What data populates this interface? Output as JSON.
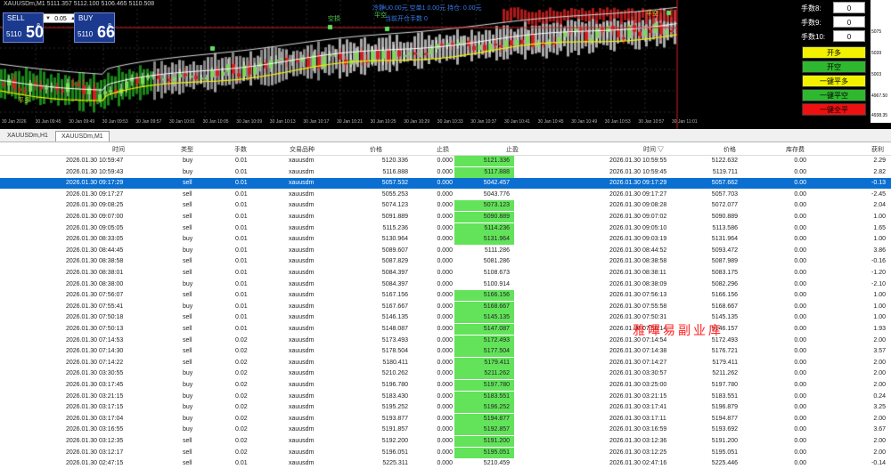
{
  "chart": {
    "title": "XAUUSDm,M1  5111.357 5112.100 5106.465 5110.508",
    "annotations": [
      {
        "text": "冷静U0.00元 空单1 0.00元 持仓: 0.00元",
        "color": "#3a7cf0"
      },
      {
        "text": "当前开仓手数 0",
        "color": "#3a7cf0"
      },
      {
        "text": "空损",
        "color": "#55d14f"
      },
      {
        "text": "平空",
        "color": "#55d14f"
      },
      {
        "text": "平多",
        "color": "#cfcf2a"
      },
      {
        "text": "平空",
        "color": "#cfcf2a"
      }
    ],
    "price_ticks": [
      "5075",
      "5039",
      "5003",
      "4967.50",
      "4938.35"
    ],
    "time_ticks": [
      "30 Jan 2026",
      "30 Jan 09:45",
      "30 Jan 09:49",
      "30 Jan 09:53",
      "30 Jan 09:57",
      "30 Jan 10:01",
      "30 Jan 10:05",
      "30 Jan 10:09",
      "30 Jan 10:13",
      "30 Jan 10:17",
      "30 Jan 10:21",
      "30 Jan 10:25",
      "30 Jan 10:29",
      "30 Jan 10:33",
      "30 Jan 10:37",
      "30 Jan 10:41",
      "30 Jan 10:45",
      "30 Jan 10:49",
      "30 Jan 10:53",
      "30 Jan 10:57",
      "30 Jan 11:01"
    ]
  },
  "trade_panel": {
    "sell_label": "SELL",
    "buy_label": "BUY",
    "lot": "0.05",
    "sell_price_small": "5110",
    "sell_price_big": "50",
    "sell_price_sup": "8",
    "buy_price_small": "5110",
    "buy_price_big": "66",
    "buy_price_sup": "8"
  },
  "right_panel": {
    "lots": [
      {
        "label": "手数8:",
        "value": "0"
      },
      {
        "label": "手数9:",
        "value": "0"
      },
      {
        "label": "手数10:",
        "value": "0"
      }
    ],
    "buttons": [
      {
        "label": "开多",
        "color": "#f2f200"
      },
      {
        "label": "开空",
        "color": "#2fb82f"
      },
      {
        "label": "一键平多",
        "color": "#f2f200"
      },
      {
        "label": "一键平空",
        "color": "#2fb82f"
      },
      {
        "label": "一键全平",
        "color": "#ee1111"
      }
    ]
  },
  "tabs": [
    {
      "label": "XAUUSDm,H1"
    },
    {
      "label": "XAUUSDm,M1"
    }
  ],
  "table": {
    "headers": [
      "时间",
      "类型",
      "手数",
      "交易品种",
      "价格",
      "止损",
      "止盈",
      "时间",
      "价格",
      "库存费",
      "获利"
    ],
    "sort_indicator": "▽",
    "rows": [
      [
        "2026.01.30 10:59:47",
        "buy",
        "0.01",
        "xauusdm",
        "5120.336",
        "0.000",
        "5121.336",
        "2026.01.30 10:59:55",
        "5122.632",
        "0.00",
        "2.29",
        true
      ],
      [
        "2026.01.30 10:59:43",
        "buy",
        "0.01",
        "xauusdm",
        "5116.888",
        "0.000",
        "5117.888",
        "2026.01.30 10:59:45",
        "5119.711",
        "0.00",
        "2.82",
        true
      ],
      [
        "2026.01.30 09:17:29",
        "sell",
        "0.01",
        "xauusdm",
        "5057.532",
        "0.000",
        "5042.457",
        "2026.01.30 09:17:29",
        "5057.662",
        "0.00",
        "-0.13",
        false
      ],
      [
        "2026.01.30 09:17:27",
        "sell",
        "0.01",
        "xauusdm",
        "5055.253",
        "0.000",
        "5043.776",
        "2026.01.30 09:17:27",
        "5057.703",
        "0.00",
        "-2.45",
        false
      ],
      [
        "2026.01.30 09:08:25",
        "sell",
        "0.01",
        "xauusdm",
        "5074.123",
        "0.000",
        "5073.123",
        "2026.01.30 09:08:28",
        "5072.077",
        "0.00",
        "2.04",
        true
      ],
      [
        "2026.01.30 09:07:00",
        "sell",
        "0.01",
        "xauusdm",
        "5091.889",
        "0.000",
        "5090.889",
        "2026.01.30 09:07:02",
        "5090.889",
        "0.00",
        "1.00",
        true
      ],
      [
        "2026.01.30 09:05:05",
        "sell",
        "0.01",
        "xauusdm",
        "5115.236",
        "0.000",
        "5114.236",
        "2026.01.30 09:05:10",
        "5113.586",
        "0.00",
        "1.65",
        true
      ],
      [
        "2026.01.30 08:33:05",
        "buy",
        "0.01",
        "xauusdm",
        "5130.964",
        "0.000",
        "5131.964",
        "2026.01.30 09:03:19",
        "5131.964",
        "0.00",
        "1.00",
        true
      ],
      [
        "2026.01.30 08:44:45",
        "buy",
        "0.01",
        "xauusdm",
        "5089.607",
        "0.000",
        "5111.286",
        "2026.01.30 08:44:52",
        "5093.472",
        "0.00",
        "3.86",
        false
      ],
      [
        "2026.01.30 08:38:58",
        "sell",
        "0.01",
        "xauusdm",
        "5087.829",
        "0.000",
        "5081.286",
        "2026.01.30 08:38:58",
        "5087.989",
        "0.00",
        "-0.16",
        false
      ],
      [
        "2026.01.30 08:38:01",
        "sell",
        "0.01",
        "xauusdm",
        "5084.397",
        "0.000",
        "5108.673",
        "2026.01.30 08:38:11",
        "5083.175",
        "0.00",
        "-1.20",
        false
      ],
      [
        "2026.01.30 08:38:00",
        "buy",
        "0.01",
        "xauusdm",
        "5084.397",
        "0.000",
        "5100.914",
        "2026.01.30 08:38:09",
        "5082.296",
        "0.00",
        "-2.10",
        false
      ],
      [
        "2026.01.30 07:56:07",
        "sell",
        "0.01",
        "xauusdm",
        "5167.156",
        "0.000",
        "5166.156",
        "2026.01.30 07:56:13",
        "5166.156",
        "0.00",
        "1.00",
        true
      ],
      [
        "2026.01.30 07:55:41",
        "buy",
        "0.01",
        "xauusdm",
        "5167.667",
        "0.000",
        "5168.667",
        "2026.01.30 07:55:58",
        "5168.667",
        "0.00",
        "1.00",
        true
      ],
      [
        "2026.01.30 07:50:18",
        "sell",
        "0.01",
        "xauusdm",
        "5146.135",
        "0.000",
        "5145.135",
        "2026.01.30 07:50:31",
        "5145.135",
        "0.00",
        "1.00",
        true
      ],
      [
        "2026.01.30 07:50:13",
        "sell",
        "0.01",
        "xauusdm",
        "5148.087",
        "0.000",
        "5147.087",
        "2026.01.30 07:50:14",
        "5146.157",
        "0.00",
        "1.93",
        true
      ],
      [
        "2026.01.30 07:14:53",
        "sell",
        "0.02",
        "xauusdm",
        "5173.493",
        "0.000",
        "5172.493",
        "2026.01.30 07:14:54",
        "5172.493",
        "0.00",
        "2.00",
        true
      ],
      [
        "2026.01.30 07:14:30",
        "sell",
        "0.02",
        "xauusdm",
        "5178.504",
        "0.000",
        "5177.504",
        "2026.01.30 07:14:38",
        "5176.721",
        "0.00",
        "3.57",
        true
      ],
      [
        "2026.01.30 07:14:22",
        "sell",
        "0.02",
        "xauusdm",
        "5180.411",
        "0.000",
        "5179.411",
        "2026.01.30 07:14:27",
        "5179.411",
        "0.00",
        "2.00",
        true
      ],
      [
        "2026.01.30 03:30:55",
        "buy",
        "0.02",
        "xauusdm",
        "5210.262",
        "0.000",
        "5211.262",
        "2026.01.30 03:30:57",
        "5211.262",
        "0.00",
        "2.00",
        true
      ],
      [
        "2026.01.30 03:17:45",
        "buy",
        "0.02",
        "xauusdm",
        "5196.780",
        "0.000",
        "5197.780",
        "2026.01.30 03:25:00",
        "5197.780",
        "0.00",
        "2.00",
        true
      ],
      [
        "2026.01.30 03:21:15",
        "buy",
        "0.02",
        "xauusdm",
        "5183.430",
        "0.000",
        "5183.551",
        "2026.01.30 03:21:15",
        "5183.551",
        "0.00",
        "0.24",
        true
      ],
      [
        "2026.01.30 03:17:15",
        "buy",
        "0.02",
        "xauusdm",
        "5195.252",
        "0.000",
        "5196.252",
        "2026.01.30 03:17:41",
        "5196.879",
        "0.00",
        "3.25",
        true
      ],
      [
        "2026.01.30 03:17:04",
        "buy",
        "0.02",
        "xauusdm",
        "5193.877",
        "0.000",
        "5194.877",
        "2026.01.30 03:17:11",
        "5194.877",
        "0.00",
        "2.00",
        true
      ],
      [
        "2026.01.30 03:16:55",
        "buy",
        "0.02",
        "xauusdm",
        "5191.857",
        "0.000",
        "5192.857",
        "2026.01.30 03:16:59",
        "5193.692",
        "0.00",
        "3.67",
        true
      ],
      [
        "2026.01.30 03:12:35",
        "sell",
        "0.02",
        "xauusdm",
        "5192.200",
        "0.000",
        "5191.200",
        "2026.01.30 03:12:36",
        "5191.200",
        "0.00",
        "2.00",
        true
      ],
      [
        "2026.01.30 03:12:17",
        "sell",
        "0.02",
        "xauusdm",
        "5196.051",
        "0.000",
        "5195.051",
        "2026.01.30 03:12:25",
        "5195.051",
        "0.00",
        "2.00",
        true
      ],
      [
        "2026.01.30 02:47:15",
        "sell",
        "0.01",
        "xauusdm",
        "5225.311",
        "0.000",
        "5210.459",
        "2026.01.30 02:47:16",
        "5225.446",
        "0.00",
        "-0.14",
        false
      ]
    ]
  },
  "selected_row_index": 2,
  "watermark": "雅嗶易副业库"
}
